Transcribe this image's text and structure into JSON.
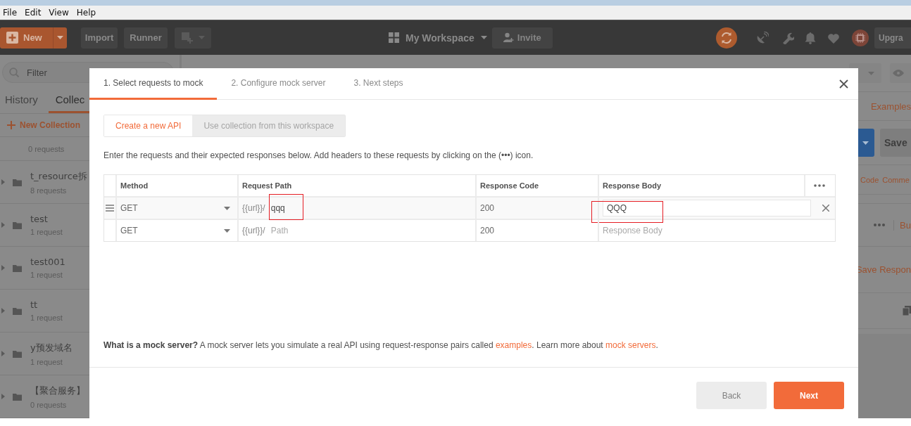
{
  "menu_bar": {
    "items": [
      "File",
      "Edit",
      "View",
      "Help"
    ]
  },
  "header": {
    "new_button": "New",
    "import_button": "Import",
    "runner_button": "Runner",
    "workspace": "My Workspace",
    "invite_button": "Invite",
    "upgrade_button": "Upgra"
  },
  "sidebar": {
    "filter": {
      "placeholder": "Filter"
    },
    "tabs": [
      {
        "label": "History",
        "selected": false
      },
      {
        "label": "Collec",
        "selected": true
      }
    ],
    "new_collection": "New Collection",
    "collections": [
      {
        "count": "0 requests"
      },
      {
        "name": "t_resource拆",
        "count": "8 requests"
      },
      {
        "name": "test",
        "count": "1 request"
      },
      {
        "name": "test001",
        "count": "1 request"
      },
      {
        "name": "tt",
        "count": "1 request"
      },
      {
        "name": "y预发域名",
        "count": "1 request"
      },
      {
        "name": "【聚合服务】",
        "count": "0 requests"
      }
    ]
  },
  "main": {
    "examples_link": "Examples",
    "save_button": "Save",
    "tabs": [
      "Code",
      "Comme"
    ],
    "more_link": "Bu",
    "save_response": "Save Respon"
  },
  "modal": {
    "steps": [
      {
        "label": "1. Select requests to mock",
        "selected": true
      },
      {
        "label": "2. Configure mock server",
        "selected": false
      },
      {
        "label": "3. Next steps",
        "selected": false
      }
    ],
    "source_options": [
      {
        "label": "Create a new API",
        "selected": true
      },
      {
        "label": "Use collection from this workspace",
        "selected": false
      }
    ],
    "instructions": "Enter the requests and their expected responses below. Add headers to these requests by clicking on the (•••) icon.",
    "table": {
      "columns": [
        "Method",
        "Request Path",
        "Response Code",
        "Response Body"
      ],
      "rows": [
        {
          "hovered": true,
          "method": "GET",
          "path_prefix": "{{url}}/",
          "path": {
            "value": "qqq",
            "annotated": true
          },
          "code": "200",
          "body": {
            "value": "QQQ",
            "focused": true,
            "annotated": true
          }
        },
        {
          "hovered": false,
          "method": "GET",
          "path_prefix": "{{url}}/",
          "path": {
            "placeholder": "Path",
            "annotated": false
          },
          "code": "200",
          "body": {
            "placeholder": "Response Body",
            "focused": false,
            "annotated": false
          }
        }
      ]
    },
    "info": [
      {
        "kind": "text",
        "text": "**What is a mock server?** A mock server lets you simulate a real API using request-response pairs called "
      },
      {
        "kind": "link",
        "text": "examples"
      },
      {
        "kind": "text",
        "text": ". Learn more about "
      },
      {
        "kind": "link",
        "text": "mock servers"
      },
      {
        "kind": "text",
        "text": "."
      }
    ],
    "buttons": [
      {
        "label": "Back",
        "kind": "secondary"
      },
      {
        "label": "Next",
        "kind": "primary"
      }
    ]
  }
}
